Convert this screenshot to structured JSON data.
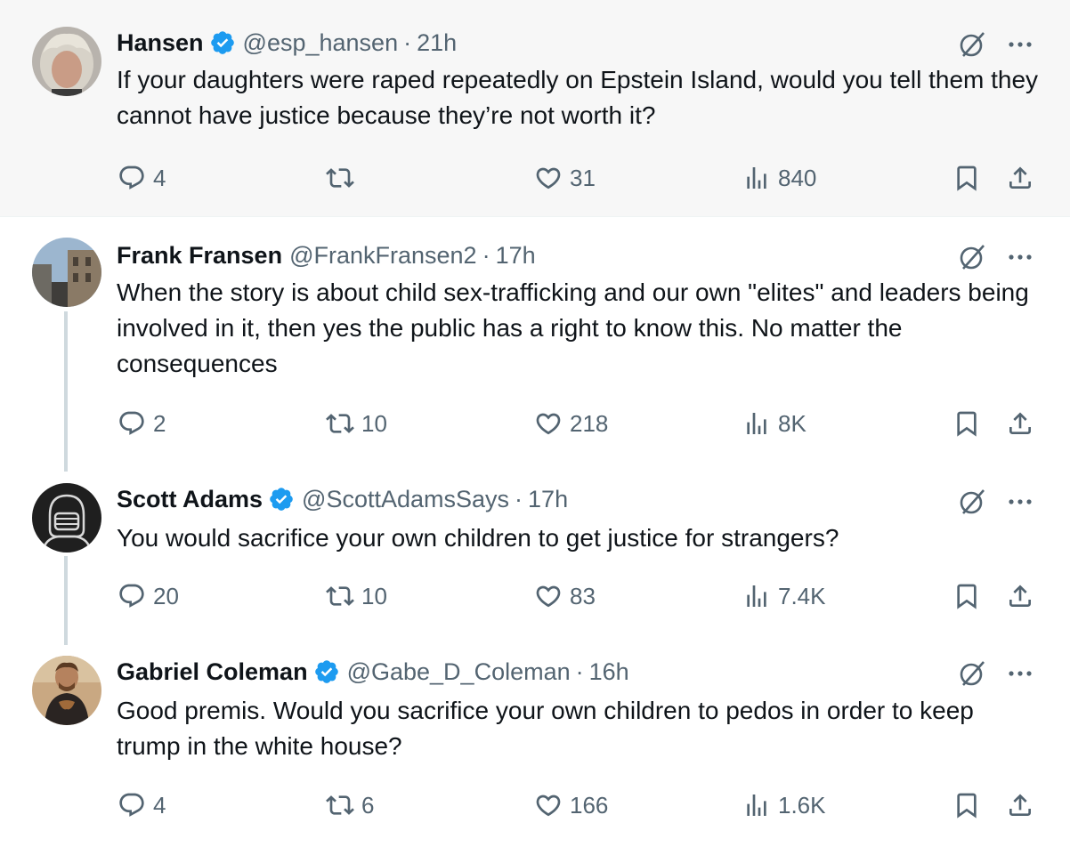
{
  "tweets": [
    {
      "name": "Hansen",
      "verified": true,
      "handle": "@esp_hansen",
      "sep": "·",
      "time": "21h",
      "text": "If your daughters were raped repeatedly on Epstein Island, would you tell them they cannot have justice because they’re not worth it?",
      "replies": "4",
      "reposts": "",
      "likes": "31",
      "views": "840"
    },
    {
      "name": "Frank Fransen",
      "verified": false,
      "handle": "@FrankFransen2",
      "sep": "·",
      "time": "17h",
      "text": "When the story is about child sex-trafficking and our own \"elites\" and leaders being involved in it, then yes the public has a right to know this. No matter the consequences",
      "replies": "2",
      "reposts": "10",
      "likes": "218",
      "views": "8K"
    },
    {
      "name": "Scott Adams",
      "verified": true,
      "handle": "@ScottAdamsSays",
      "sep": "·",
      "time": "17h",
      "text": "You would sacrifice your own children to get justice for strangers?",
      "replies": "20",
      "reposts": "10",
      "likes": "83",
      "views": "7.4K"
    },
    {
      "name": "Gabriel Coleman",
      "verified": true,
      "handle": "@Gabe_D_Coleman",
      "sep": "·",
      "time": "16h",
      "text": "Good premis. Would you sacrifice your own children to pedos in order to keep trump in the white house?",
      "replies": "4",
      "reposts": "6",
      "likes": "166",
      "views": "1.6K"
    }
  ],
  "icons": {
    "reply": "reply-icon",
    "repost": "repost-icon",
    "like": "heart-icon",
    "views": "views-icon",
    "bookmark": "bookmark-icon",
    "share": "share-icon",
    "grok": "grok-icon",
    "more": "more-icon",
    "verified": "verified-badge-icon"
  },
  "colors": {
    "text": "#0f1419",
    "secondary": "#536471",
    "verified": "#1d9bf0",
    "highlight_bg": "#f7f7f7",
    "thread_line": "#cfd9de"
  }
}
